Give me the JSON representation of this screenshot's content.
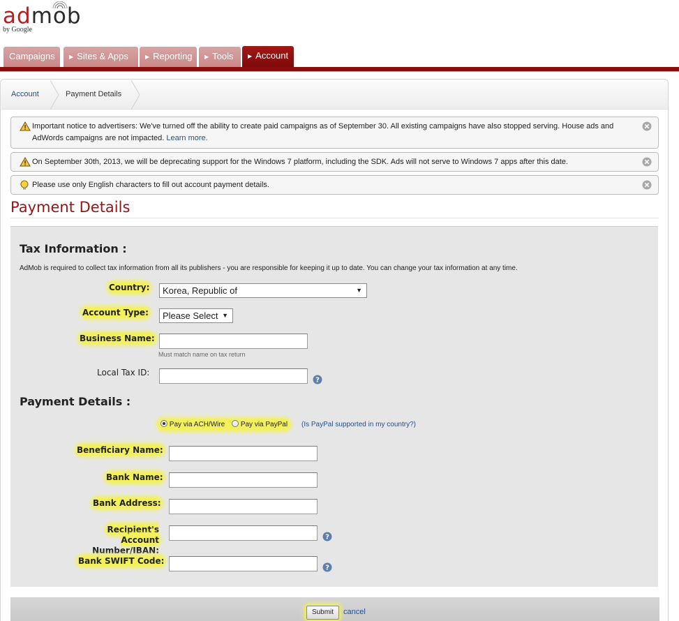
{
  "brand": {
    "logo_text_ad": "ad",
    "logo_text_mob": "mob",
    "tagline": "by Google"
  },
  "nav": {
    "tabs": [
      {
        "label": "Campaigns"
      },
      {
        "label": "Sites & Apps"
      },
      {
        "label": "Reporting"
      },
      {
        "label": "Tools"
      },
      {
        "label": "Account"
      }
    ],
    "active_tab": "Account"
  },
  "breadcrumb": {
    "items": [
      "Account",
      "Payment Details"
    ]
  },
  "notices": [
    {
      "icon": "warning-icon",
      "text": "Important notice to advertisers: We've turned off the ability to create paid campaigns as of September 30. All existing campaigns have also stopped serving. House ads and AdWords campaigns are not impacted.",
      "link": "Learn more."
    },
    {
      "icon": "warning-icon",
      "text": "On September 30th, 2013, we will be deprecating support for the Windows 7 platform, including the SDK. Ads will not serve to Windows 7 apps after this date."
    },
    {
      "icon": "lightbulb-icon",
      "text": "Please use only English characters to fill out account payment details."
    }
  ],
  "page_title": "Payment Details",
  "tax": {
    "heading": "Tax Information :",
    "description": "AdMob is required to collect tax information from all its publishers - you are responsible for keeping it up to date. You can change your tax information at any time.",
    "country_label": "Country:",
    "country_value": "Korea, Republic of",
    "account_type_label": "Account Type:",
    "account_type_value": "Please Select",
    "business_name_label": "Business Name:",
    "business_name_hint": "Must match name on tax return",
    "local_tax_label": "Local Tax ID:"
  },
  "payment": {
    "heading": "Payment Details :",
    "option_ach": "Pay via ACH/Wire",
    "option_paypal": "Pay via PayPal",
    "selected": "Pay via ACH/Wire",
    "paypal_help_link": "(Is PayPal supported in my country?)",
    "beneficiary_label": "Beneficiary Name:",
    "bank_name_label": "Bank Name:",
    "bank_address_label": "Bank Address:",
    "account_number_label_1": "Recipient's Account",
    "account_number_label_2": "Number/IBAN:",
    "swift_label": "Bank SWIFT Code:"
  },
  "actions": {
    "submit": "Submit",
    "cancel": "cancel"
  },
  "colors": {
    "brand_red": "#9b1313",
    "highlight": "#f3f15a",
    "link": "#1e4f8c"
  }
}
